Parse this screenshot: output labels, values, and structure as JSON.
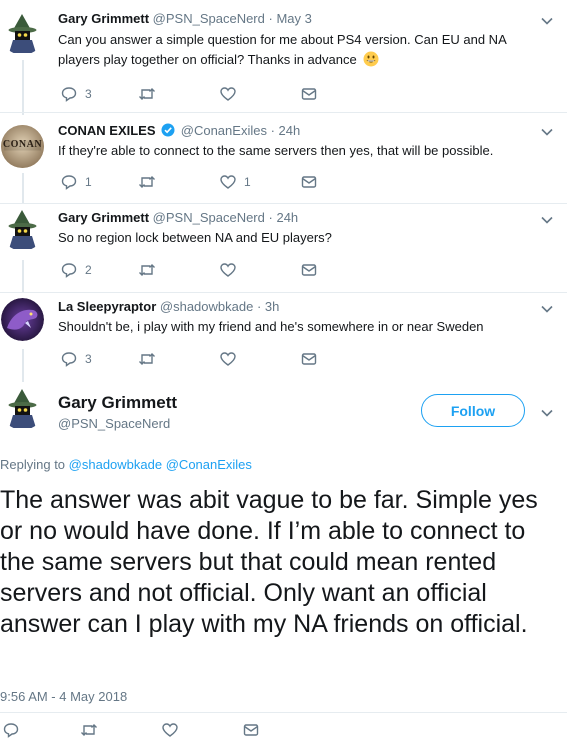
{
  "colors": {
    "accent": "#1da1f2",
    "text": "#14171a",
    "muted": "#657786",
    "divider": "#e6ecf0"
  },
  "thread": [
    {
      "name": "Gary Grimmett",
      "handle": "@PSN_SpaceNerd",
      "sep": "·",
      "time": "May 3",
      "text": "Can you answer a simple question for me about PS4 version. Can EU and NA players play together on official? Thanks in advance",
      "emoji": "grinning-face-icon",
      "replies": "3",
      "retweets": "",
      "likes": ""
    },
    {
      "name": "CONAN EXILES",
      "handle": "@ConanExiles",
      "sep": "·",
      "time": "24h",
      "verified": true,
      "avatar_text": "CONAN",
      "text": "If they're able to connect to the same servers then yes, that will be possible.",
      "replies": "1",
      "retweets": "",
      "likes": "1"
    },
    {
      "name": "Gary Grimmett",
      "handle": "@PSN_SpaceNerd",
      "sep": "·",
      "time": "24h",
      "text": "So no region lock between NA and EU players?",
      "replies": "2",
      "retweets": "",
      "likes": ""
    },
    {
      "name": "La Sleepyraptor",
      "handle": "@shadowbkade",
      "sep": "·",
      "time": "3h",
      "text": "Shouldn't be, i play with my friend and he's somewhere in or near Sweden",
      "replies": "3",
      "retweets": "",
      "likes": ""
    }
  ],
  "main": {
    "name": "Gary Grimmett",
    "handle": "@PSN_SpaceNerd",
    "follow_label": "Follow",
    "replying_prefix": "Replying to",
    "replying_users": [
      "@shadowbkade",
      "@ConanExiles"
    ],
    "text": "The answer was abit vague to be far. Simple yes or no would have done. If I’m able to connect to the same servers but that could mean rented servers and not official. Only want an official answer can I play with my NA friends on official.",
    "timestamp": "9:56 AM - 4 May 2018"
  }
}
